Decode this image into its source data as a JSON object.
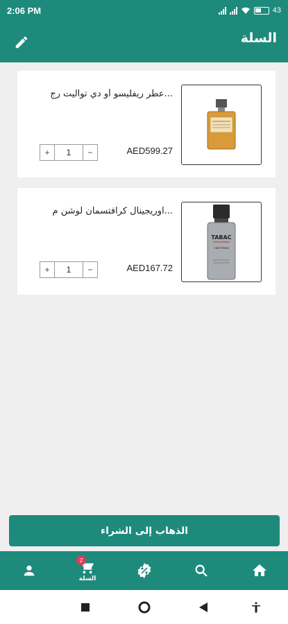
{
  "status_bar": {
    "time": "2:06 PM",
    "battery": "43"
  },
  "header": {
    "title": "السلة"
  },
  "cart_items": [
    {
      "name": "عطر ريفليسو أو دي تواليت رج...",
      "price": "AED599.27",
      "quantity": "1",
      "plus": "+",
      "minus": "−"
    },
    {
      "name": "اوريجينال كرافتسمان لوشن م...",
      "price": "AED167.72",
      "quantity": "1",
      "plus": "+",
      "minus": "−"
    }
  ],
  "bottle_label": {
    "brand": "TABAC",
    "line": "CRAFTSMAN"
  },
  "checkout": {
    "label": "الذهاب إلى الشراء"
  },
  "bottom_nav": {
    "cart_label": "السلة",
    "cart_badge": "2"
  },
  "colors": {
    "primary": "#1e8a7c",
    "badge": "#e03a5b",
    "background": "#efefef"
  }
}
